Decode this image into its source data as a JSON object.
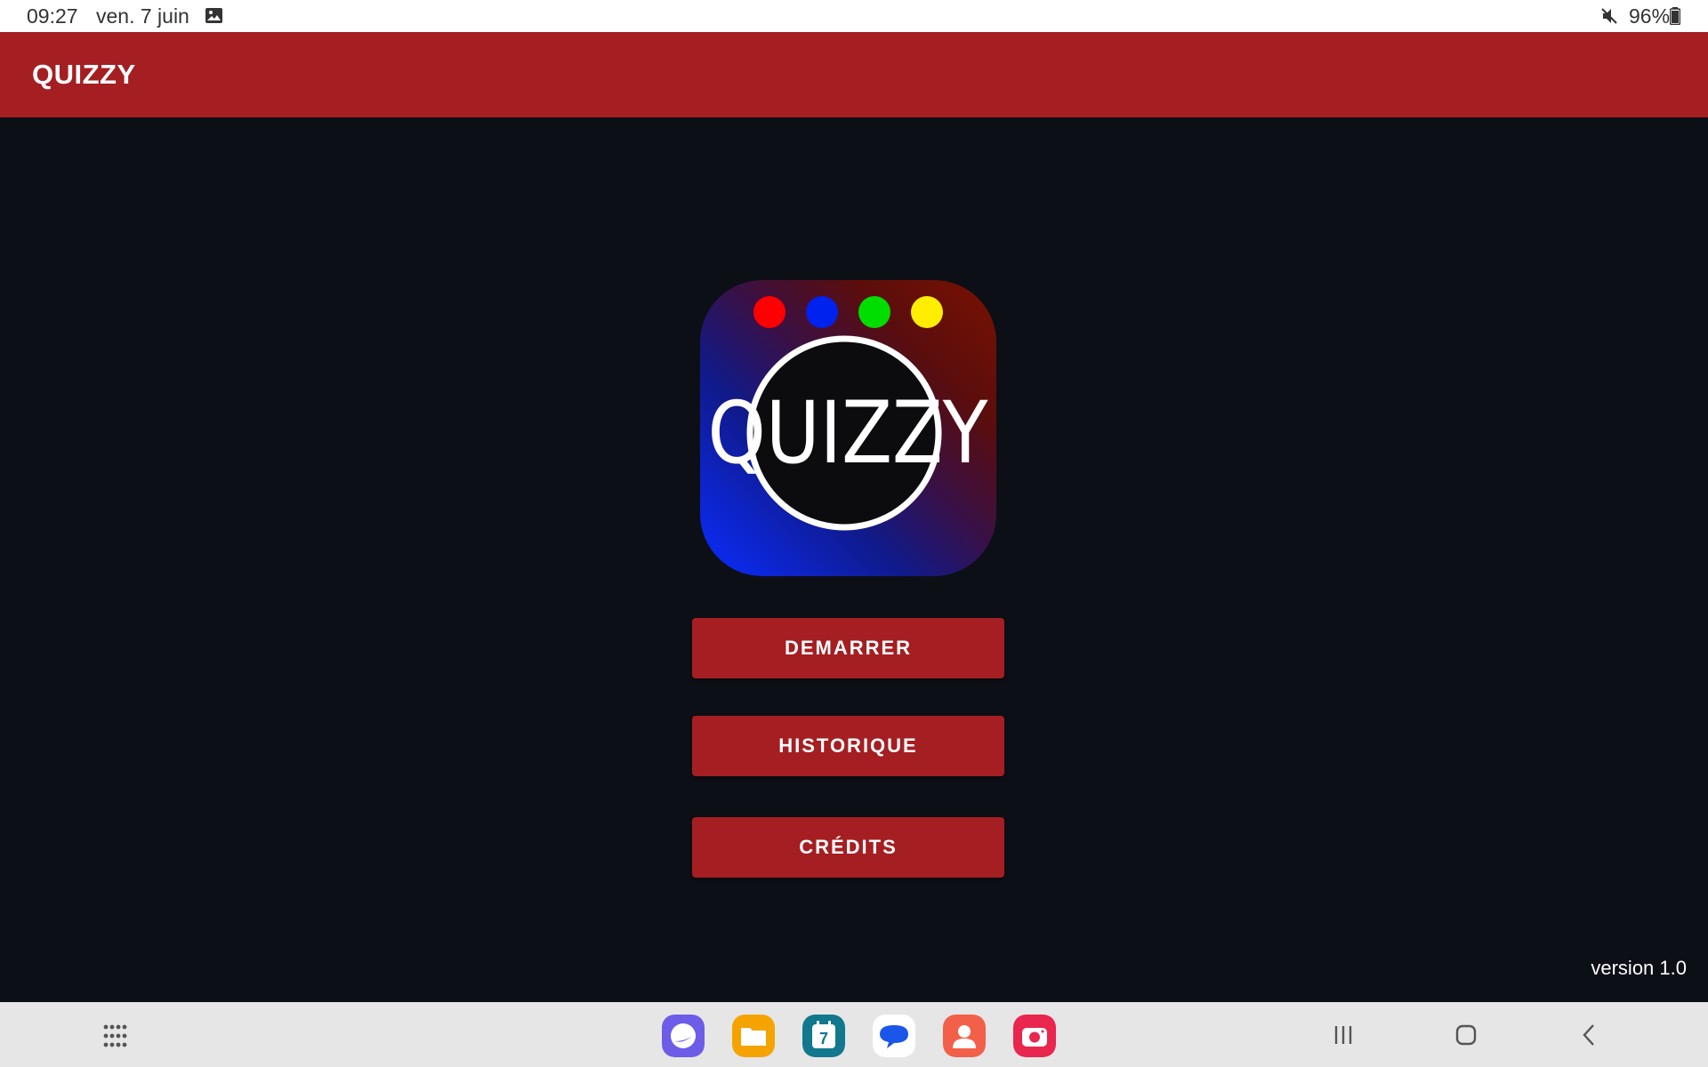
{
  "status_bar": {
    "time": "09:27",
    "date": "ven. 7 juin",
    "battery": "96%",
    "icons": [
      "image-notification-icon",
      "mute-icon",
      "battery-icon"
    ]
  },
  "app_bar": {
    "title": "QUIZZY"
  },
  "logo": {
    "text": "QUIZZY",
    "dot_colors": [
      "#ff0000",
      "#0022ee",
      "#00dd00",
      "#ffee00"
    ]
  },
  "menu": {
    "start_label": "DEMARRER",
    "history_label": "HISTORIQUE",
    "credits_label": "CRÉDITS"
  },
  "footer": {
    "version": "version 1.0"
  },
  "taskbar": {
    "calendar_day": "7",
    "apps": [
      "internet-app-icon",
      "files-app-icon",
      "calendar-app-icon",
      "messages-app-icon",
      "contacts-app-icon",
      "camera-app-icon"
    ],
    "nav": [
      "recent-apps-icon",
      "home-icon",
      "back-icon"
    ]
  },
  "colors": {
    "brand": "#a51e22",
    "background": "#0d0f17"
  }
}
